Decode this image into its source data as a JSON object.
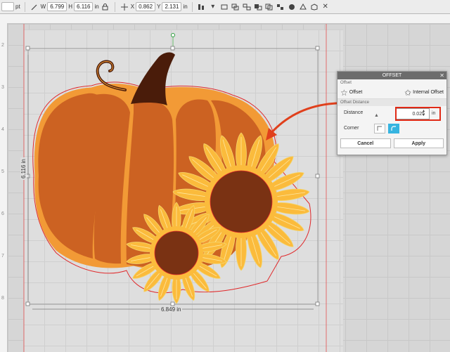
{
  "toolbar": {
    "stroke_unit": "pt",
    "w_label": "W",
    "w_value": "6.799",
    "h_label": "H",
    "h_value": "6.116",
    "h_unit": "in",
    "x_label": "X",
    "x_value": "0.862",
    "y_label": "Y",
    "y_value": "2.131",
    "pos_unit": "in",
    "icons": [
      "pen-icon",
      "lock-icon",
      "move-icon",
      "align-icon",
      "group-icon",
      "ungroup-icon",
      "arrange-icon",
      "duplicate-icon",
      "fill-icon",
      "shape-icon",
      "close-icon"
    ]
  },
  "ruler": {
    "left_numbers": [
      "2",
      "3",
      "4",
      "5",
      "6",
      "7",
      "8"
    ]
  },
  "canvas": {
    "height_dim": "6.116 in",
    "width_dim": "6.849 in"
  },
  "colors": {
    "pumpkin_dark": "#cc6222",
    "pumpkin_light": "#f29a36",
    "stem": "#4a1c0a",
    "petal": "#fbbb3c",
    "center": "#7a3213",
    "offset_line": "#e0292b",
    "arrow": "#e0401c",
    "active_corner": "#36b4e0"
  },
  "panel": {
    "title": "OFFSET",
    "subtitle": "Offset",
    "mode_offset": "Offset",
    "mode_internal": "Internal Offset",
    "section": "Offset Distance",
    "distance_label": "Distance",
    "distance_value": "0.025",
    "distance_unit": "in",
    "corner_label": "Corner",
    "cancel_label": "Cancel",
    "apply_label": "Apply"
  }
}
